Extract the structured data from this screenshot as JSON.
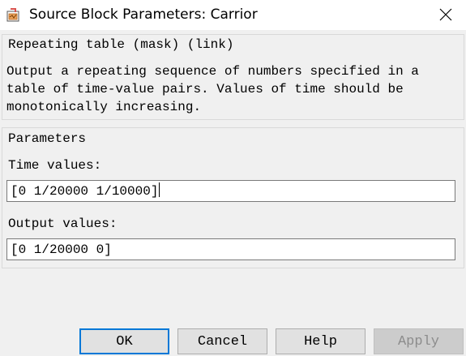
{
  "window": {
    "title": "Source Block Parameters: Carrior",
    "icons": {
      "app": "simulink-block-icon",
      "close": "close-icon"
    }
  },
  "description": {
    "title": "Repeating table (mask) (link)",
    "body": "Output a repeating sequence of numbers specified in a\ntable of time-value pairs. Values of time should be\nmonotonically increasing."
  },
  "parameters": {
    "title": "Parameters",
    "time_values": {
      "label": "Time values:",
      "value": "[0 1/20000 1/10000]"
    },
    "output_values": {
      "label": "Output values:",
      "value": "[0 1/20000 0]"
    }
  },
  "buttons": {
    "ok": "OK",
    "cancel": "Cancel",
    "help": "Help",
    "apply": "Apply"
  },
  "colors": {
    "focus_border": "#0078d7",
    "disabled_text": "#8c8c8c",
    "dialog_bg": "#f0f0f0"
  }
}
